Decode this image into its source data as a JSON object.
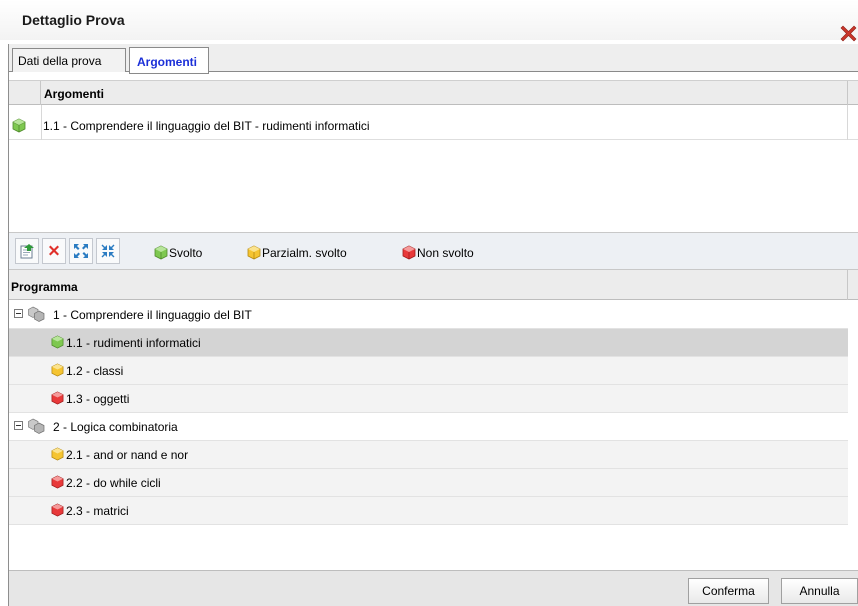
{
  "dialog": {
    "title": "Dettaglio Prova"
  },
  "tabs": [
    {
      "label": "Dati della prova",
      "active": false
    },
    {
      "label": "Argomenti",
      "active": true
    }
  ],
  "argomenti_grid": {
    "column": "Argomenti",
    "rows": [
      {
        "status": "svolto",
        "text": "1.1 - Comprendere il linguaggio del BIT - rudimenti informatici"
      }
    ]
  },
  "toolbar": {
    "buttons": [
      "add-icon",
      "delete-icon",
      "expand-all-icon",
      "collapse-all-icon"
    ],
    "legend": [
      {
        "status": "svolto",
        "label": "Svolto"
      },
      {
        "status": "parziale",
        "label": "Parzialm. svolto"
      },
      {
        "status": "non_svolto",
        "label": "Non svolto"
      }
    ]
  },
  "programma": {
    "column": "Programma",
    "groups": [
      {
        "label": "1 - Comprendere il linguaggio del BIT",
        "items": [
          {
            "label": "1.1 - rudimenti informatici",
            "status": "svolto",
            "selected": true
          },
          {
            "label": "1.2 - classi",
            "status": "parziale",
            "selected": false
          },
          {
            "label": "1.3 - oggetti",
            "status": "non_svolto",
            "selected": false
          }
        ]
      },
      {
        "label": "2 - Logica combinatoria",
        "items": [
          {
            "label": "2.1 - and or nand e nor",
            "status": "parziale",
            "selected": false
          },
          {
            "label": "2.2 - do while cicli",
            "status": "non_svolto",
            "selected": false
          },
          {
            "label": "2.3 - matrici",
            "status": "non_svolto",
            "selected": false
          }
        ]
      }
    ]
  },
  "footer": {
    "confirm_label": "Conferma",
    "cancel_label": "Annulla"
  },
  "colors": {
    "svolto": "#7ec850",
    "parziale": "#f5c431",
    "non_svolto": "#e8393a",
    "active_tab": "#1b2fd8",
    "close": "#c0392b"
  }
}
